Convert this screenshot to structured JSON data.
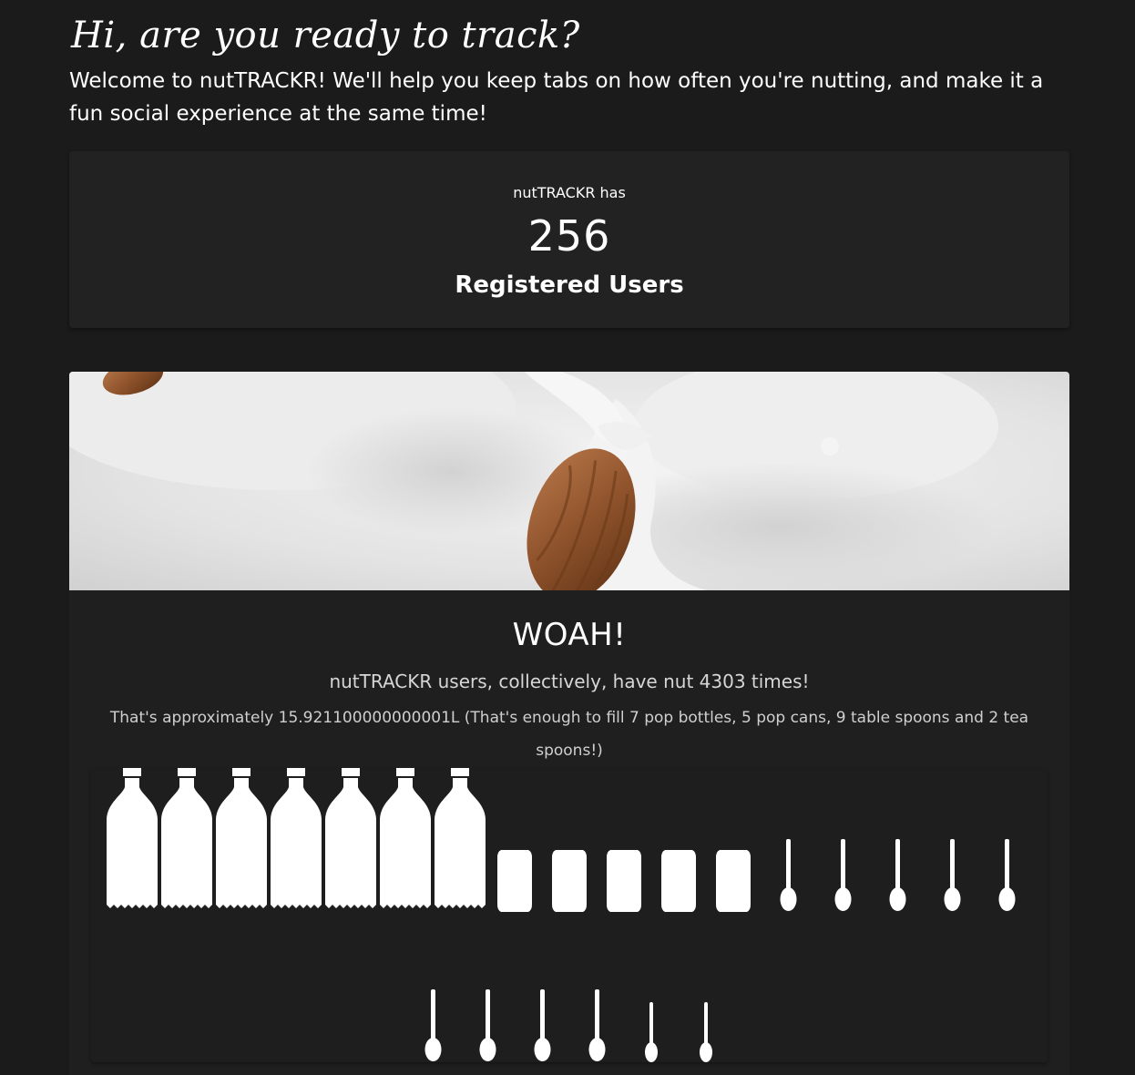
{
  "greeting": "Hi, are you ready to track?",
  "intro": "Welcome to nutTRACKR! We'll help you keep tabs on how often you're nutting, and make it a fun social experience at the same time!",
  "users_card": {
    "prefix": "nutTRACKR has",
    "count": "256",
    "label": "Registered Users"
  },
  "stats": {
    "hero_image": "almond-in-milk-splash",
    "title": "WOAH!",
    "collective": "nutTRACKR users, collectively, have nut 4303 times!",
    "approx": "That's approximately 15.921100000000001L (That's enough to fill 7 pop bottles, 5 pop cans, 9 table spoons and 2 tea spoons!)",
    "counts": {
      "pop_bottles": 7,
      "pop_cans": 5,
      "table_spoons": 9,
      "tea_spoons": 2
    }
  },
  "colors": {
    "background": "#1b1b1b",
    "card": "#222222",
    "icon": "#ffffff"
  },
  "icons": {
    "bottle": "bottle-icon",
    "can": "can-icon",
    "tablespoon": "tablespoon-icon",
    "teaspoon": "teaspoon-icon"
  }
}
